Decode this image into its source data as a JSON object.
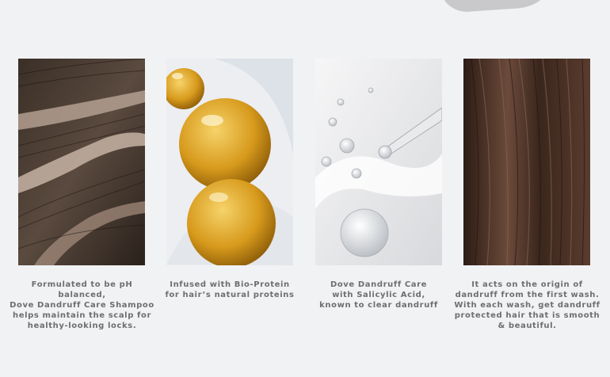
{
  "features": [
    {
      "image": "scalp-hair-parting",
      "caption_lines": [
        "Formulated to be pH balanced,",
        "Dove Dandruff Care Shampoo",
        "helps maintain the scalp for",
        "healthy-looking locks."
      ]
    },
    {
      "image": "golden-protein-bubbles",
      "caption_lines": [
        "Infused with Bio-Protein",
        "for hair’s natural proteins"
      ]
    },
    {
      "image": "clear-serum-dropper",
      "caption_lines": [
        "Dove Dandruff Care",
        "with Salicylic Acid,",
        "known to clear dandruff"
      ]
    },
    {
      "image": "smooth-brown-hair",
      "caption_lines": [
        "It acts on the origin of",
        "dandruff from the first wash.",
        "With each wash, get dandruff",
        "protected hair that is smooth",
        "& beautiful."
      ]
    }
  ]
}
